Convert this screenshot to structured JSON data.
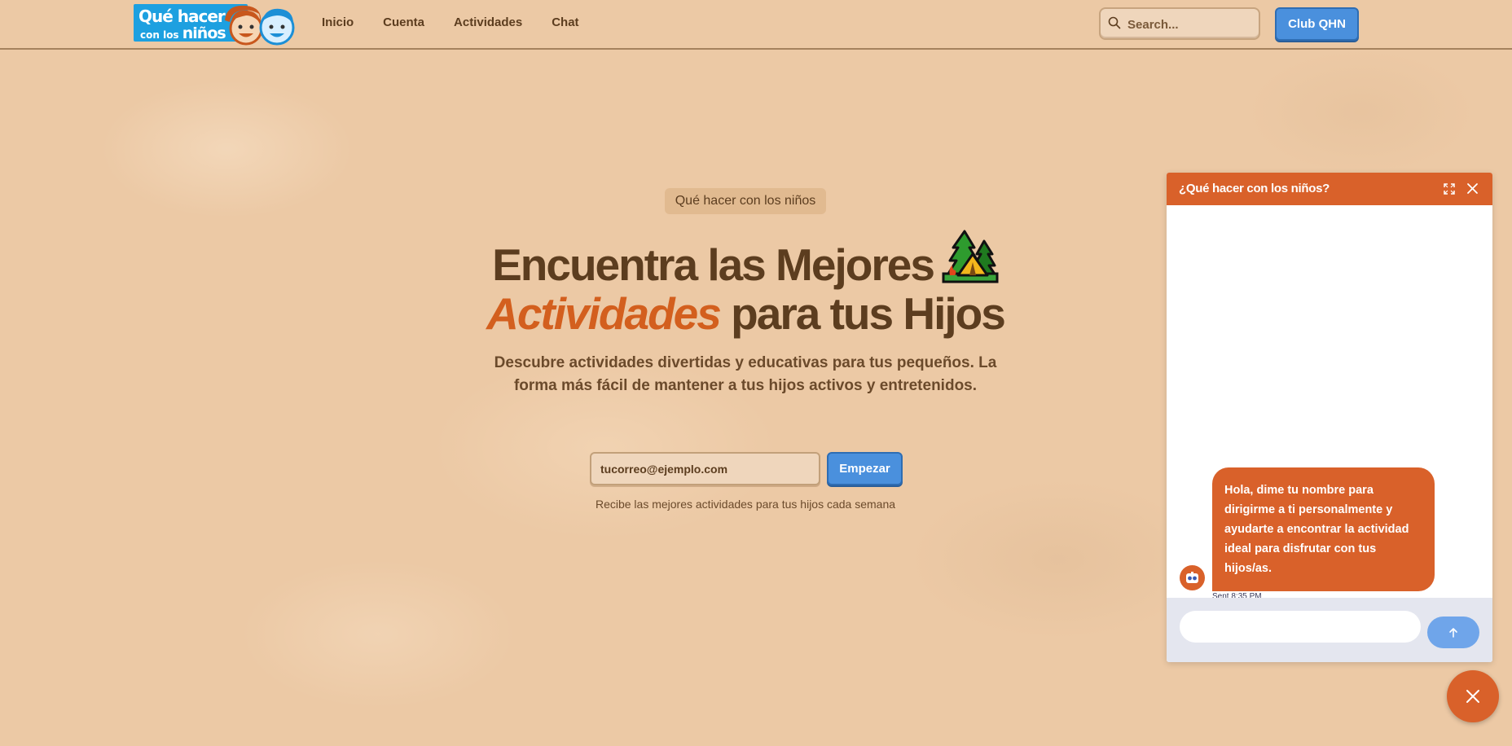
{
  "navbar": {
    "logo": {
      "line1": "Qué hacer",
      "line2_prefix": "con los",
      "line2_main": "niños"
    },
    "links": [
      {
        "label": "Inicio"
      },
      {
        "label": "Cuenta"
      },
      {
        "label": "Actividades"
      },
      {
        "label": "Chat"
      }
    ],
    "search": {
      "placeholder": "Search...",
      "icon": "search-icon"
    },
    "club_button": "Club QHN"
  },
  "hero": {
    "badge": "Qué hacer con los niños",
    "title_line1": "Encuentra las Mejores",
    "title_accent": "Actividades",
    "title_rest": "para tus Hijos",
    "title_icon": "camping-tent-icon",
    "subtitle": "Descubre actividades divertidas y educativas para tus pequeños. La forma más fácil de mantener a tus hijos activos y entretenidos.",
    "email_placeholder": "tucorreo@ejemplo.com",
    "start_button": "Empezar",
    "note": "Recibe las mejores actividades para tus hijos cada semana"
  },
  "chat": {
    "title": "¿Qué hacer con los niños?",
    "messages": [
      {
        "text": "Hola, dime tu nombre para dirigirme a ti personalmente y ayudarte a encontrar la actividad ideal para disfrutar con tus hijos/as.",
        "time": "Sent 8:35 PM"
      }
    ],
    "input_value": "",
    "icons": {
      "expand": "expand-icon",
      "close": "close-icon",
      "send": "arrow-up-icon",
      "launcher": "close-icon"
    }
  },
  "colors": {
    "background": "#ecc9a5",
    "text": "#5c3d1f",
    "accent_orange": "#d9612a",
    "button_blue": "#4a90dd",
    "send_blue": "#6fa5ea"
  }
}
